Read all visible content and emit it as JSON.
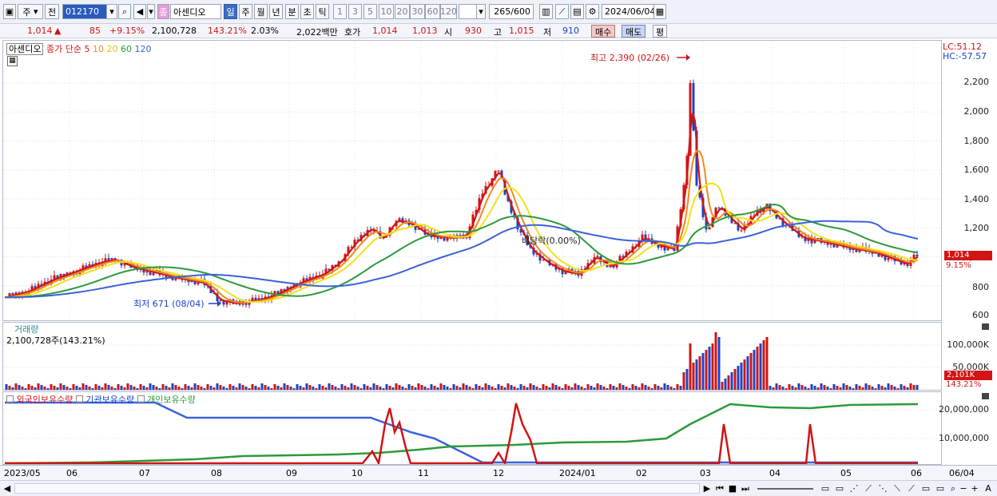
{
  "toolbar": {
    "market": "주",
    "sign": "전",
    "code": "012170",
    "type_badge": "종",
    "stock_name": "아센디오",
    "periods": [
      "일",
      "주",
      "월",
      "년",
      "분",
      "초",
      "틱"
    ],
    "intervals": [
      "1",
      "3",
      "5",
      "10",
      "20",
      "30",
      "60",
      "120"
    ],
    "count": "265",
    "total": "/600",
    "date": "2024/06/04"
  },
  "quote": {
    "price": "1,014",
    "change": "85",
    "change_pct": "+9.15%",
    "volume": "2,100,728",
    "volume_ratio": "143.21%",
    "turnover": "2.03%",
    "amount": "2,022백만",
    "ask_label": "호가",
    "ask1": "1,014",
    "ask2": "1,013",
    "open_label": "시",
    "open": "930",
    "high_label": "고",
    "high": "1,015",
    "low_label": "저",
    "low": "910",
    "buy_btn": "매수",
    "sell_btn": "매도",
    "flat_btn": "평"
  },
  "price_pane": {
    "legend": {
      "name": "아센디오",
      "ma_label": "종가 단순",
      "ma5": "5",
      "ma10": "10",
      "ma20": "20",
      "ma60": "60",
      "ma120": "120"
    },
    "lc": "LC:51.12",
    "hc": "HC:-57.57",
    "high_annotation": "최고 2,390 (02/26)",
    "low_annotation": "최저 671 (08/04)",
    "dividend_annotation": "배당락(0.00%)",
    "last_price_tag": "1,014",
    "last_pct": "9.15%",
    "yticks": [
      "2,200",
      "2,000",
      "1,800",
      "1,600",
      "1,400",
      "1,200",
      "1,000",
      "800",
      "600"
    ]
  },
  "volume_pane": {
    "title": "거래량",
    "value": "2,100,728주(143.21%)",
    "yticks": [
      "100,000K",
      "50,000K"
    ],
    "last_tag": "2,101K",
    "last_pct": "143.21%"
  },
  "holding_pane": {
    "legend1": "외국인보유수량",
    "legend2": "기관보유수량",
    "legend3": "개인보유수량",
    "yticks": [
      "20,000,000",
      "10,000,000"
    ]
  },
  "xaxis": {
    "ticks": [
      "2023/05",
      "06",
      "07",
      "08",
      "09",
      "10",
      "11",
      "12",
      "2024/01",
      "02",
      "03",
      "04",
      "05",
      "06"
    ],
    "right_label": "06/04"
  },
  "colors": {
    "up": "#d21414",
    "down": "#1a44c8",
    "ma5": "#d21414",
    "ma10": "#f08a1c",
    "ma20": "#f2e21a",
    "ma60": "#2c9a3a",
    "ma120": "#3a62d8"
  }
}
